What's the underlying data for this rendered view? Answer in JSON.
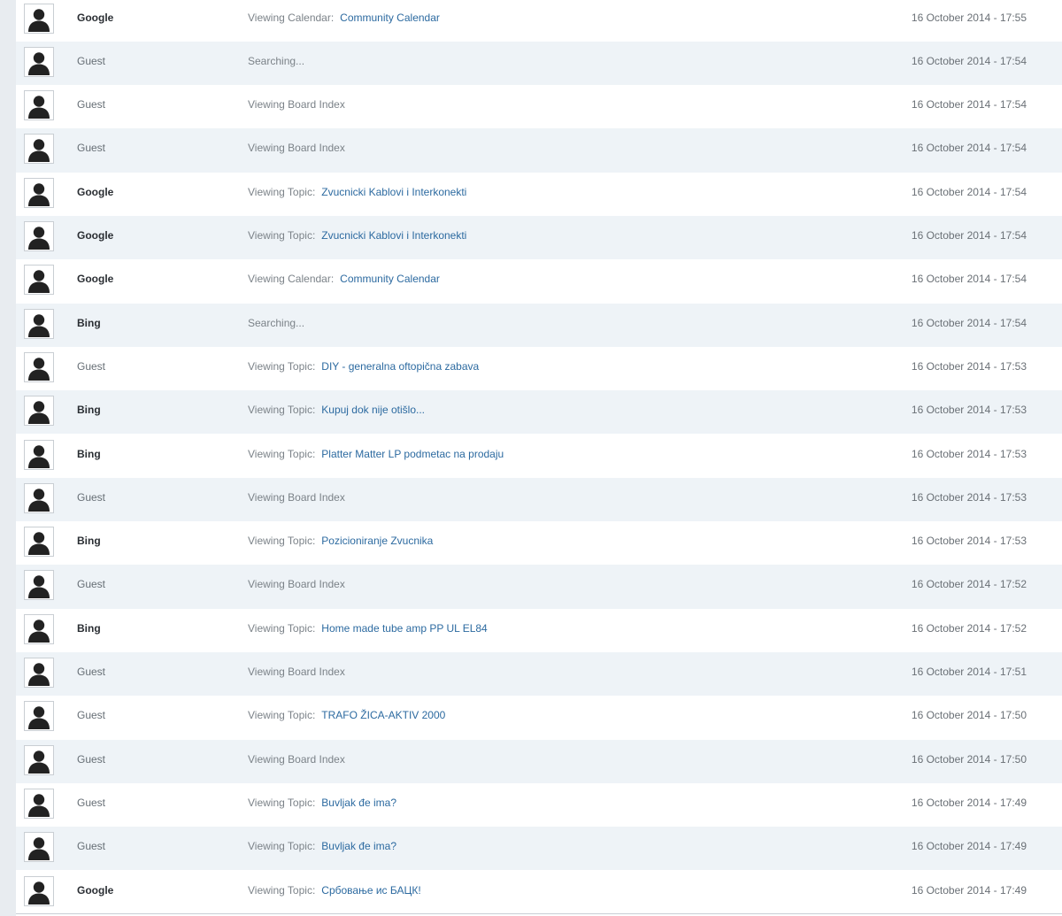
{
  "rows": [
    {
      "user": "Google",
      "bot": true,
      "label": "Viewing Calendar:",
      "link": "Community Calendar",
      "time": "16 October 2014 - 17:55"
    },
    {
      "user": "Guest",
      "bot": false,
      "label": "Searching...",
      "link": "",
      "time": "16 October 2014 - 17:54"
    },
    {
      "user": "Guest",
      "bot": false,
      "label": "Viewing Board Index",
      "link": "",
      "time": "16 October 2014 - 17:54"
    },
    {
      "user": "Guest",
      "bot": false,
      "label": "Viewing Board Index",
      "link": "",
      "time": "16 October 2014 - 17:54"
    },
    {
      "user": "Google",
      "bot": true,
      "label": "Viewing Topic:",
      "link": "Zvucnicki Kablovi i Interkonekti",
      "time": "16 October 2014 - 17:54"
    },
    {
      "user": "Google",
      "bot": true,
      "label": "Viewing Topic:",
      "link": "Zvucnicki Kablovi i Interkonekti",
      "time": "16 October 2014 - 17:54"
    },
    {
      "user": "Google",
      "bot": true,
      "label": "Viewing Calendar:",
      "link": "Community Calendar",
      "time": "16 October 2014 - 17:54"
    },
    {
      "user": "Bing",
      "bot": true,
      "label": "Searching...",
      "link": "",
      "time": "16 October 2014 - 17:54"
    },
    {
      "user": "Guest",
      "bot": false,
      "label": "Viewing Topic:",
      "link": "DIY - generalna oftopična zabava",
      "time": "16 October 2014 - 17:53"
    },
    {
      "user": "Bing",
      "bot": true,
      "label": "Viewing Topic:",
      "link": "Kupuj dok nije otišlo...",
      "time": "16 October 2014 - 17:53"
    },
    {
      "user": "Bing",
      "bot": true,
      "label": "Viewing Topic:",
      "link": "Platter Matter LP podmetac na prodaju",
      "time": "16 October 2014 - 17:53"
    },
    {
      "user": "Guest",
      "bot": false,
      "label": "Viewing Board Index",
      "link": "",
      "time": "16 October 2014 - 17:53"
    },
    {
      "user": "Bing",
      "bot": true,
      "label": "Viewing Topic:",
      "link": "Pozicioniranje Zvucnika",
      "time": "16 October 2014 - 17:53"
    },
    {
      "user": "Guest",
      "bot": false,
      "label": "Viewing Board Index",
      "link": "",
      "time": "16 October 2014 - 17:52"
    },
    {
      "user": "Bing",
      "bot": true,
      "label": "Viewing Topic:",
      "link": "Home made tube amp PP UL EL84",
      "time": "16 October 2014 - 17:52"
    },
    {
      "user": "Guest",
      "bot": false,
      "label": "Viewing Board Index",
      "link": "",
      "time": "16 October 2014 - 17:51"
    },
    {
      "user": "Guest",
      "bot": false,
      "label": "Viewing Topic:",
      "link": "TRAFO ŽICA-AKTIV 2000",
      "time": "16 October 2014 - 17:50"
    },
    {
      "user": "Guest",
      "bot": false,
      "label": "Viewing Board Index",
      "link": "",
      "time": "16 October 2014 - 17:50"
    },
    {
      "user": "Guest",
      "bot": false,
      "label": "Viewing Topic:",
      "link": "Buvljak đe ima?",
      "time": "16 October 2014 - 17:49"
    },
    {
      "user": "Guest",
      "bot": false,
      "label": "Viewing Topic:",
      "link": "Buvljak đe ima?",
      "time": "16 October 2014 - 17:49"
    },
    {
      "user": "Google",
      "bot": true,
      "label": "Viewing Topic:",
      "link": "Србовање ис БАЦК!",
      "time": "16 October 2014 - 17:49"
    }
  ],
  "colors": {
    "row_even": "#ffffff",
    "row_odd": "#eef3f7",
    "link": "#2c6aa0",
    "bot_user": "#2a2e33",
    "guest_user": "#666e75"
  },
  "icons": {
    "avatar": "default-avatar-icon"
  }
}
